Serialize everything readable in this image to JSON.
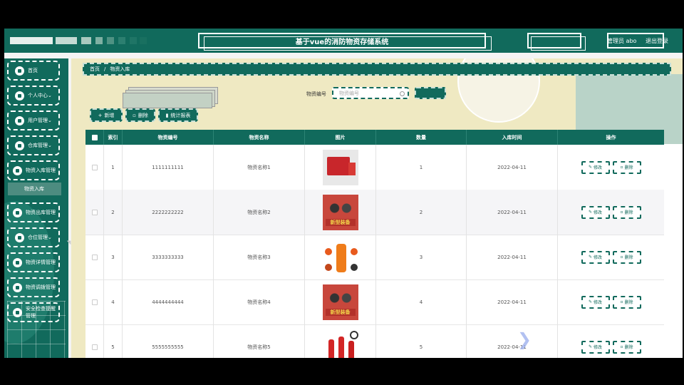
{
  "header": {
    "title": "基于vue的消防物资存储系统",
    "user_label": "管理员 abo",
    "logout_label": "退出登录"
  },
  "sidebar": {
    "items": [
      {
        "label": "首页"
      },
      {
        "label": "个人中心"
      },
      {
        "label": "用户管理"
      },
      {
        "label": "仓库管理"
      },
      {
        "label": "物资入库管理"
      },
      {
        "label": "物资出库管理"
      },
      {
        "label": "仓位管理"
      },
      {
        "label": "物资详情管理"
      },
      {
        "label": "物资调拨管理"
      },
      {
        "label": "安全检查提醒管理"
      }
    ],
    "active_sub": "物资入库"
  },
  "breadcrumb": {
    "home": "首页",
    "current": "物资入库"
  },
  "search": {
    "label": "物资编号",
    "placeholder": "物资编号"
  },
  "toolbar": {
    "add_label": "新增",
    "delete_label": "删除",
    "stats_label": "统计报表"
  },
  "table": {
    "headers": [
      "索引",
      "物资编号",
      "物资名称",
      "图片",
      "数量",
      "入库时间",
      "操作"
    ],
    "rows": [
      {
        "index": "1",
        "code": "1111111111",
        "name": "物资名称1",
        "image": "fire-truck",
        "qty": "1",
        "date": "2022-04-11"
      },
      {
        "index": "2",
        "code": "2222222222",
        "name": "物资名称2",
        "image": "fire-gear",
        "qty": "2",
        "date": "2022-04-11"
      },
      {
        "index": "3",
        "code": "3333333333",
        "name": "物资名称3",
        "image": "fire-suit",
        "qty": "3",
        "date": "2022-04-11"
      },
      {
        "index": "4",
        "code": "4444444444",
        "name": "物资名称4",
        "image": "fire-gear",
        "qty": "4",
        "date": "2022-04-11"
      },
      {
        "index": "5",
        "code": "5555555555",
        "name": "物资名称5",
        "image": "extinguisher",
        "qty": "5",
        "date": "2022-04-11"
      }
    ],
    "edit_label": "修改",
    "delete_label": "删除",
    "gear_banner": "新型装备"
  },
  "colors": {
    "primary": "#116a5c",
    "accent_bg": "#efe9c2"
  }
}
